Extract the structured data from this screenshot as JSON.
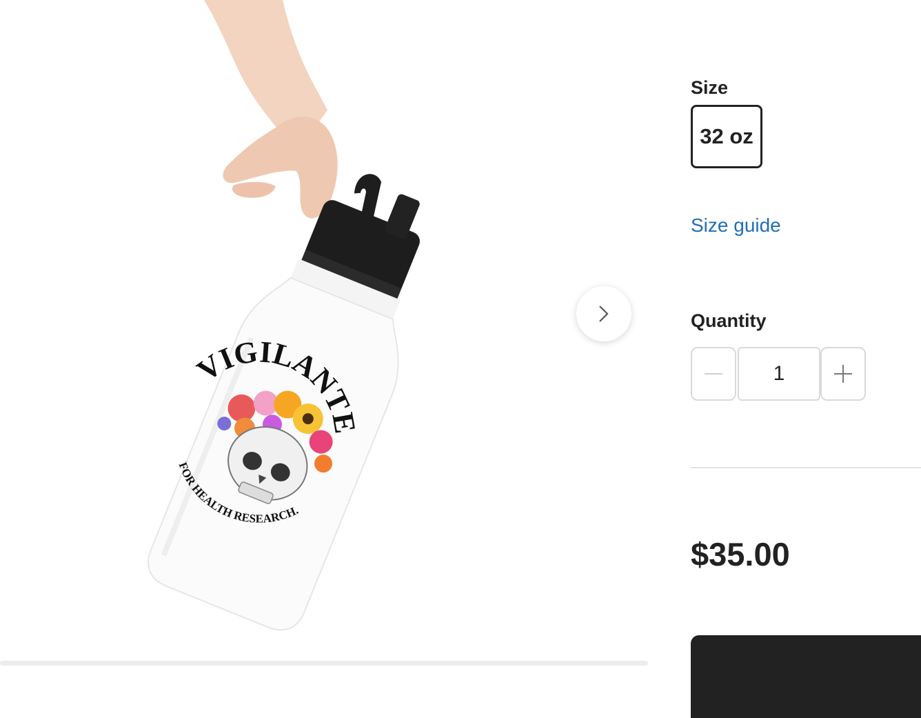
{
  "gallery": {
    "image_alt": "White stainless steel water bottle with VIGILANTE FOR HEALTH RESEARCH skull and flowers design",
    "bottle_text_top": "VIGILANTE",
    "bottle_text_bottom": "FOR HEALTH RESEARCH.",
    "next_icon": "chevron-right-icon"
  },
  "size": {
    "label": "Size",
    "selected": "32 oz",
    "guide_link": "Size guide"
  },
  "quantity": {
    "label": "Quantity",
    "value": "1",
    "minus_icon": "minus-icon",
    "plus_icon": "plus-icon"
  },
  "price": "$35.00",
  "colors": {
    "link": "#1f6fb5",
    "text": "#222222",
    "button": "#222222",
    "border": "#d9d9d9"
  }
}
